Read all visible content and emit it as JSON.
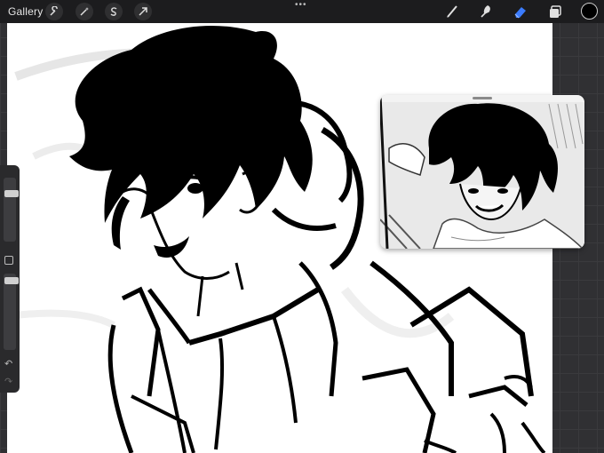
{
  "topbar": {
    "gallery_label": "Gallery",
    "more_label": "•••",
    "left_tools": [
      "wrench-icon",
      "magic-wand-icon",
      "selection-s-icon",
      "transform-arrow-icon"
    ],
    "right_tools": [
      "brush-icon",
      "smudge-icon",
      "eraser-icon",
      "layers-icon"
    ],
    "active_tool": "eraser-icon",
    "active_tool_color": "#3b7cff",
    "current_color": "#000000"
  },
  "sidebar": {
    "brush_size_level": 0.2,
    "opacity_level": 0.1,
    "undo_icon": "undo-icon",
    "redo_icon": "redo-icon"
  },
  "canvas": {
    "background": "#ffffff"
  },
  "reference": {
    "title": ""
  }
}
